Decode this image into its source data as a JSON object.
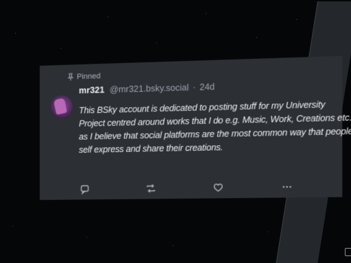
{
  "pinned_label": "Pinned",
  "post": {
    "display_name": "mr321",
    "handle": "@mr321.bsky.social",
    "separator": "·",
    "age": "24d",
    "text": "This BSky account is dedicated to posting stuff for my University Project centred around works that I do e.g. Music, Work, Creations etc. as I believe that social platforms are the most common way that people self express and share their creations."
  },
  "icons": {
    "pinned": "pin-icon",
    "reply": "reply-icon",
    "repost": "repost-icon",
    "like": "heart-icon",
    "more": "more-icon"
  },
  "colors": {
    "background": "#050608",
    "panel": "#2c2f34",
    "text": "#f3f4f6",
    "muted": "#9ea7b2"
  }
}
